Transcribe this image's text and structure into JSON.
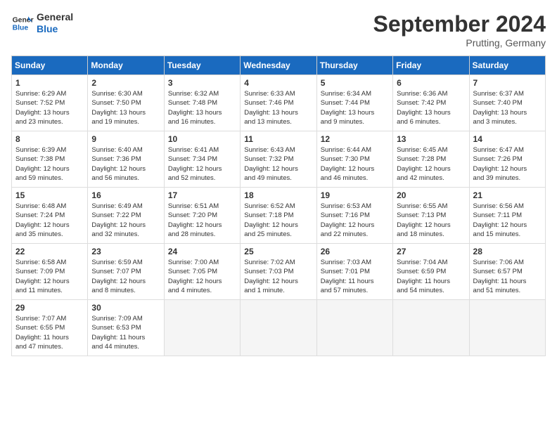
{
  "header": {
    "logo_line1": "General",
    "logo_line2": "Blue",
    "month": "September 2024",
    "location": "Prutting, Germany"
  },
  "weekdays": [
    "Sunday",
    "Monday",
    "Tuesday",
    "Wednesday",
    "Thursday",
    "Friday",
    "Saturday"
  ],
  "weeks": [
    [
      {
        "day": "1",
        "info": "Sunrise: 6:29 AM\nSunset: 7:52 PM\nDaylight: 13 hours\nand 23 minutes."
      },
      {
        "day": "2",
        "info": "Sunrise: 6:30 AM\nSunset: 7:50 PM\nDaylight: 13 hours\nand 19 minutes."
      },
      {
        "day": "3",
        "info": "Sunrise: 6:32 AM\nSunset: 7:48 PM\nDaylight: 13 hours\nand 16 minutes."
      },
      {
        "day": "4",
        "info": "Sunrise: 6:33 AM\nSunset: 7:46 PM\nDaylight: 13 hours\nand 13 minutes."
      },
      {
        "day": "5",
        "info": "Sunrise: 6:34 AM\nSunset: 7:44 PM\nDaylight: 13 hours\nand 9 minutes."
      },
      {
        "day": "6",
        "info": "Sunrise: 6:36 AM\nSunset: 7:42 PM\nDaylight: 13 hours\nand 6 minutes."
      },
      {
        "day": "7",
        "info": "Sunrise: 6:37 AM\nSunset: 7:40 PM\nDaylight: 13 hours\nand 3 minutes."
      }
    ],
    [
      {
        "day": "8",
        "info": "Sunrise: 6:39 AM\nSunset: 7:38 PM\nDaylight: 12 hours\nand 59 minutes."
      },
      {
        "day": "9",
        "info": "Sunrise: 6:40 AM\nSunset: 7:36 PM\nDaylight: 12 hours\nand 56 minutes."
      },
      {
        "day": "10",
        "info": "Sunrise: 6:41 AM\nSunset: 7:34 PM\nDaylight: 12 hours\nand 52 minutes."
      },
      {
        "day": "11",
        "info": "Sunrise: 6:43 AM\nSunset: 7:32 PM\nDaylight: 12 hours\nand 49 minutes."
      },
      {
        "day": "12",
        "info": "Sunrise: 6:44 AM\nSunset: 7:30 PM\nDaylight: 12 hours\nand 46 minutes."
      },
      {
        "day": "13",
        "info": "Sunrise: 6:45 AM\nSunset: 7:28 PM\nDaylight: 12 hours\nand 42 minutes."
      },
      {
        "day": "14",
        "info": "Sunrise: 6:47 AM\nSunset: 7:26 PM\nDaylight: 12 hours\nand 39 minutes."
      }
    ],
    [
      {
        "day": "15",
        "info": "Sunrise: 6:48 AM\nSunset: 7:24 PM\nDaylight: 12 hours\nand 35 minutes."
      },
      {
        "day": "16",
        "info": "Sunrise: 6:49 AM\nSunset: 7:22 PM\nDaylight: 12 hours\nand 32 minutes."
      },
      {
        "day": "17",
        "info": "Sunrise: 6:51 AM\nSunset: 7:20 PM\nDaylight: 12 hours\nand 28 minutes."
      },
      {
        "day": "18",
        "info": "Sunrise: 6:52 AM\nSunset: 7:18 PM\nDaylight: 12 hours\nand 25 minutes."
      },
      {
        "day": "19",
        "info": "Sunrise: 6:53 AM\nSunset: 7:16 PM\nDaylight: 12 hours\nand 22 minutes."
      },
      {
        "day": "20",
        "info": "Sunrise: 6:55 AM\nSunset: 7:13 PM\nDaylight: 12 hours\nand 18 minutes."
      },
      {
        "day": "21",
        "info": "Sunrise: 6:56 AM\nSunset: 7:11 PM\nDaylight: 12 hours\nand 15 minutes."
      }
    ],
    [
      {
        "day": "22",
        "info": "Sunrise: 6:58 AM\nSunset: 7:09 PM\nDaylight: 12 hours\nand 11 minutes."
      },
      {
        "day": "23",
        "info": "Sunrise: 6:59 AM\nSunset: 7:07 PM\nDaylight: 12 hours\nand 8 minutes."
      },
      {
        "day": "24",
        "info": "Sunrise: 7:00 AM\nSunset: 7:05 PM\nDaylight: 12 hours\nand 4 minutes."
      },
      {
        "day": "25",
        "info": "Sunrise: 7:02 AM\nSunset: 7:03 PM\nDaylight: 12 hours\nand 1 minute."
      },
      {
        "day": "26",
        "info": "Sunrise: 7:03 AM\nSunset: 7:01 PM\nDaylight: 11 hours\nand 57 minutes."
      },
      {
        "day": "27",
        "info": "Sunrise: 7:04 AM\nSunset: 6:59 PM\nDaylight: 11 hours\nand 54 minutes."
      },
      {
        "day": "28",
        "info": "Sunrise: 7:06 AM\nSunset: 6:57 PM\nDaylight: 11 hours\nand 51 minutes."
      }
    ],
    [
      {
        "day": "29",
        "info": "Sunrise: 7:07 AM\nSunset: 6:55 PM\nDaylight: 11 hours\nand 47 minutes."
      },
      {
        "day": "30",
        "info": "Sunrise: 7:09 AM\nSunset: 6:53 PM\nDaylight: 11 hours\nand 44 minutes."
      },
      {
        "day": "",
        "info": ""
      },
      {
        "day": "",
        "info": ""
      },
      {
        "day": "",
        "info": ""
      },
      {
        "day": "",
        "info": ""
      },
      {
        "day": "",
        "info": ""
      }
    ]
  ]
}
